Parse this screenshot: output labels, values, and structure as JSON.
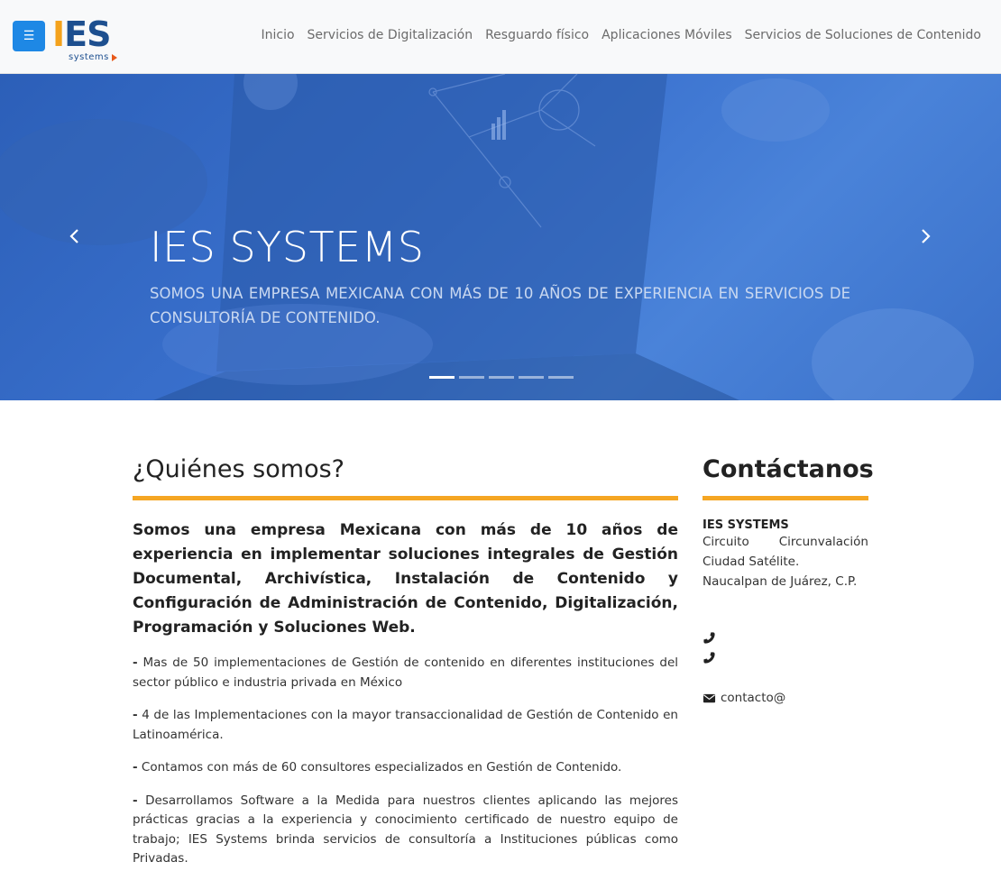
{
  "nav": {
    "menu_icon": "menu-icon",
    "logo": {
      "letters_i": "I",
      "letters_es": "ES",
      "sub": "systems"
    },
    "links": [
      "Inicio",
      "Servicios de Digitalización",
      "Resguardo físico",
      "Aplicaciones Móviles",
      "Servicios de Soluciones de Contenido"
    ]
  },
  "hero": {
    "title": "IES SYSTEMS",
    "subtitle": "SOMOS UNA EMPRESA MEXICANA CON MÁS DE 10 AÑOS DE EXPERIENCIA EN SERVICIOS DE CONSULTORÍA DE CONTENIDO.",
    "prev_icon": "chevron-left-icon",
    "next_icon": "chevron-right-icon",
    "slides": 5,
    "active_slide": 1
  },
  "about": {
    "title": "¿Quiénes somos?",
    "lead": "Somos una empresa Mexicana con más de 10 años de experiencia en implementar soluciones integrales de Gestión Documental, Archivística, Instalación de Contenido y Configuración de Administración de Contenido, Digitalización, Programación y Soluciones Web.",
    "bullet_mark": "-",
    "bullets": [
      "Mas de 50 implementaciones de Gestión de contenido en diferentes instituciones del sector público e industria privada en México",
      "4 de las Implementaciones con la mayor transaccionalidad de Gestión de Contenido en Latinoamérica.",
      "Contamos con más de 60 consultores especializados en Gestión de Contenido.",
      "Desarrollamos Software a la Medida para nuestros clientes aplicando las mejores prácticas gracias a la experiencia y conocimiento certificado de nuestro equipo de trabajo; IES Systems brinda servicios de consultoría a Instituciones públicas como Privadas."
    ]
  },
  "contact": {
    "title": "Contáctanos",
    "company": "IES SYSTEMS",
    "address_line1_a": "Circuito",
    "address_line1_b": "Circunvalación",
    "address_line2": "Ciudad Satélite.",
    "address_line3": "Naucalpan de Juárez, C.P.",
    "phone_icon": "phone-icon",
    "mail_icon": "envelope-icon",
    "email": "contacto@"
  },
  "colors": {
    "accent": "#f5a623",
    "brand_blue": "#1d4f8f",
    "button_blue": "#1e88e5",
    "hero_blue": "#3b72cf"
  }
}
